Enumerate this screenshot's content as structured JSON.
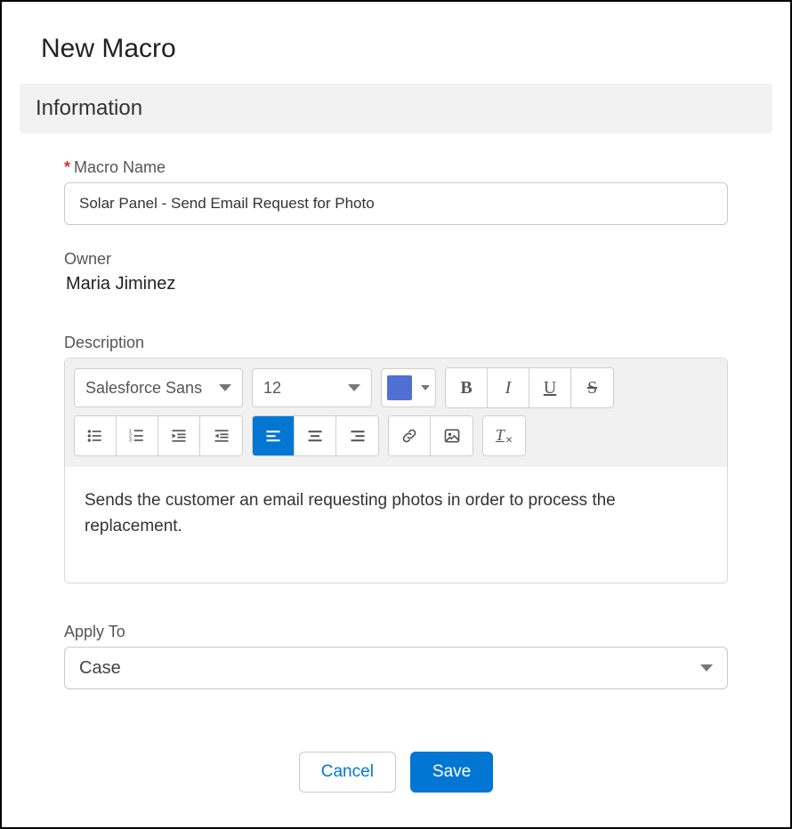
{
  "page_title": "New Macro",
  "section_header": "Information",
  "fields": {
    "macro_name": {
      "label": "Macro Name",
      "required": true,
      "value": "Solar Panel - Send Email Request for Photo"
    },
    "owner": {
      "label": "Owner",
      "value": "Maria Jiminez"
    },
    "description": {
      "label": "Description",
      "value": "Sends the customer an email requesting photos in order to process the replacement."
    },
    "apply_to": {
      "label": "Apply To",
      "value": "Case"
    }
  },
  "rte": {
    "font": "Salesforce Sans",
    "size": "12",
    "color": "#4f6fd4",
    "align_active": "left"
  },
  "buttons": {
    "cancel": "Cancel",
    "save": "Save"
  }
}
